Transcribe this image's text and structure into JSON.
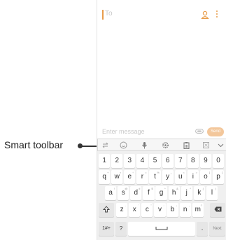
{
  "callout": {
    "label": "Smart toolbar"
  },
  "recipient": {
    "placeholder": "To"
  },
  "compose": {
    "placeholder": "Enter message",
    "send_label": "Send"
  },
  "colors": {
    "accent": "#e89c4a",
    "send_bg": "#f3c79b"
  },
  "toolbar": {
    "icons": [
      "swap-icon",
      "emoji-icon",
      "mic-icon",
      "settings-icon",
      "clipboard-icon",
      "keyboard-mode-icon",
      "chevron-down-icon"
    ]
  },
  "keyboard": {
    "number_row": [
      "1",
      "2",
      "3",
      "4",
      "5",
      "6",
      "7",
      "8",
      "9",
      "0"
    ],
    "row1": [
      "q",
      "w",
      "e",
      "r",
      "t",
      "y",
      "u",
      "i",
      "o",
      "p"
    ],
    "row1_hints": [
      "+",
      "×",
      "÷",
      "=",
      "%",
      "_",
      "<",
      ">",
      "[",
      "]"
    ],
    "row2": [
      "a",
      "s",
      "d",
      "f",
      "g",
      "h",
      "j",
      "k",
      "l"
    ],
    "row2_hints": [
      "!",
      "@",
      "#",
      "$",
      "^",
      "&",
      "*",
      "(",
      ")"
    ],
    "row3": [
      "z",
      "x",
      "c",
      "v",
      "b",
      "n",
      "m"
    ],
    "row3_hints": [
      "-",
      "'",
      "\"",
      ":",
      ";",
      ",",
      "?"
    ],
    "symbols_label": "1#+",
    "question_label": "?",
    "period_label": ".",
    "next_label": "Next"
  }
}
